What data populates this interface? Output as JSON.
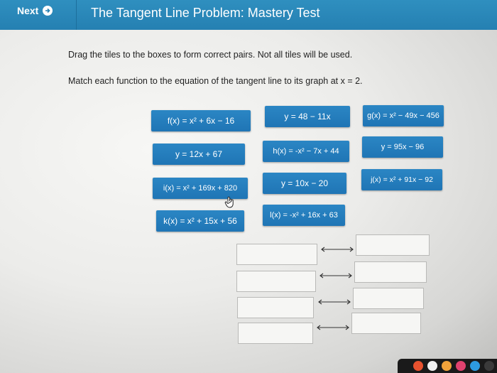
{
  "header": {
    "next_label": "Next",
    "title": "The Tangent Line Problem: Mastery Test"
  },
  "instructions": {
    "line1": "Drag the tiles to the boxes to form correct pairs. Not all tiles will be used.",
    "line2": "Match each function to the equation of the tangent line to its graph at x = 2."
  },
  "tiles": {
    "t1": "f(x) = x² + 6x − 16",
    "t2": "y = 48 − 11x",
    "t3": "g(x) = x² − 49x − 456",
    "t4": "y = 12x + 67",
    "t5": "h(x) = -x² − 7x + 44",
    "t6": "y = 95x − 96",
    "t7": "i(x) = x² + 169x + 820",
    "t8": "y = 10x − 20",
    "t9": "j(x) = x² + 91x − 92",
    "t10": "k(x) = x² + 15x + 56",
    "t11": "l(x) = -x² + 16x + 63"
  },
  "colors": {
    "header": "#2580b2",
    "tile": "#1f75b5",
    "drop_box": "#f6f6f4"
  },
  "icons": {
    "next": "arrow-right-circle-icon",
    "pair": "double-arrow-icon",
    "cursor": "hand-pointer-icon"
  }
}
